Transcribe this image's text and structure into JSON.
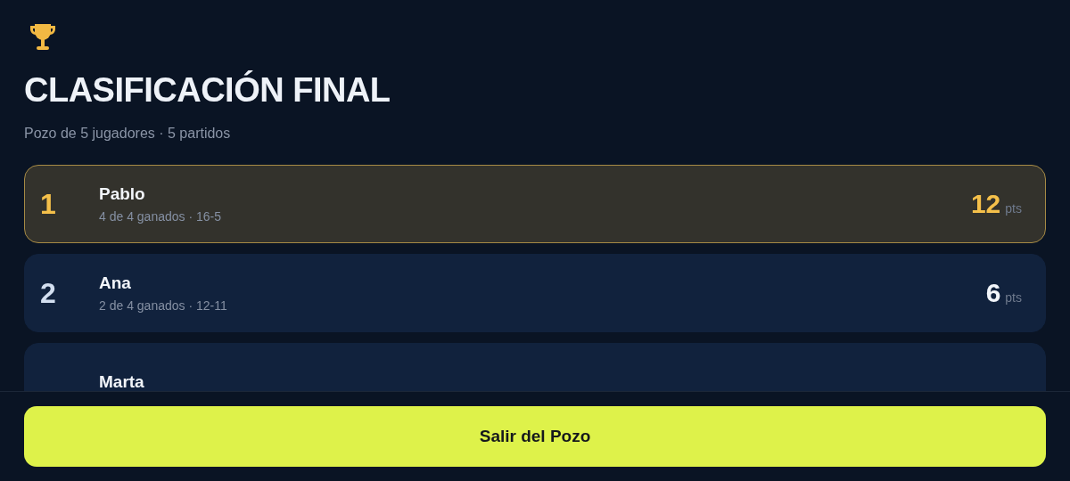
{
  "header": {
    "title": "CLASIFICACIÓN FINAL",
    "subtitle": "Pozo de 5 jugadores · 5 partidos"
  },
  "standings": [
    {
      "rank": "1",
      "name": "Pablo",
      "record": "4 de 4 ganados · 16-5",
      "points": "12",
      "unit": "pts",
      "leader": true,
      "color": "#f5c04a"
    },
    {
      "rank": "2",
      "name": "Ana",
      "record": "2 de 4 ganados · 12-11",
      "points": "6",
      "unit": "pts",
      "leader": false,
      "color": "#d3dff0"
    },
    {
      "name": "Marta",
      "leader": false
    }
  ],
  "footer": {
    "button": "Salir del Pozo"
  }
}
